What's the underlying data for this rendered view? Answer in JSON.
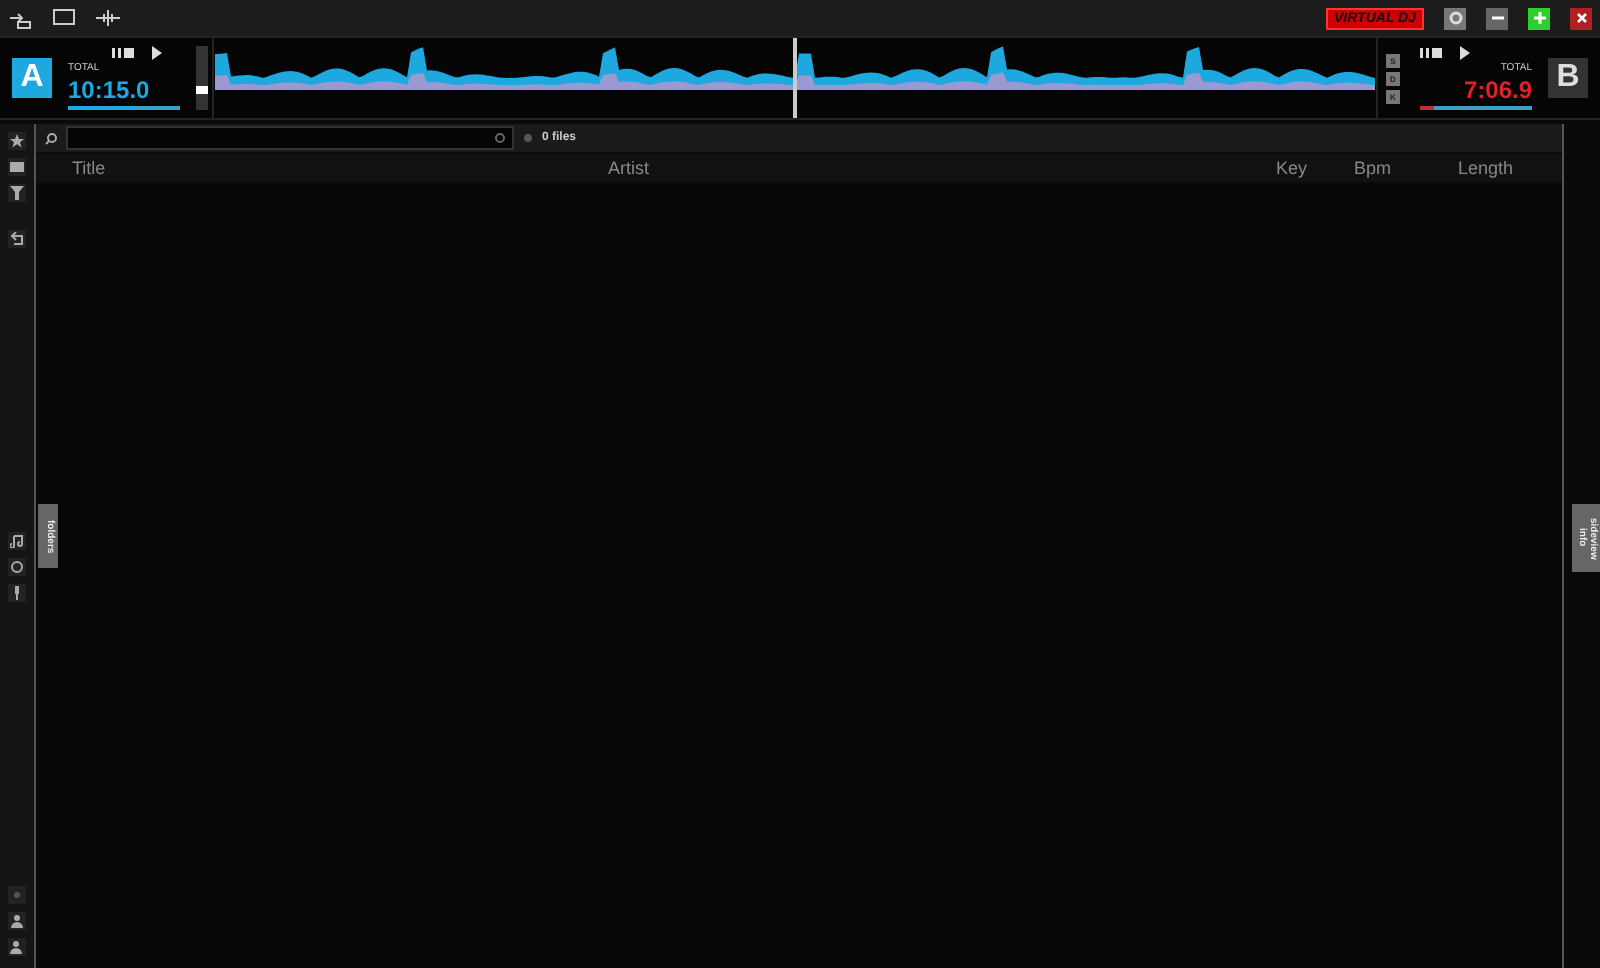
{
  "toolbar": {
    "logo": "VIRTUAL DJ"
  },
  "decks": [
    {
      "letter": "A",
      "total_label": "TOTAL",
      "time": "10:15.0",
      "color": "#1ea8e0",
      "position": {
        "level": 0.6
      }
    },
    {
      "letter": "B",
      "total_label": "TOTAL",
      "time": "7:06.9",
      "color": "#e0202a",
      "position": {
        "level": 0.12
      }
    }
  ],
  "fader": {
    "level": 0.3
  },
  "deck_buttons": [
    "S",
    "D",
    "K"
  ],
  "browser": {
    "file_count": "0 files",
    "columns": [
      "Title",
      "Artist",
      "Key",
      "Bpm",
      "Length"
    ],
    "left_tab": "folders",
    "right_tab": [
      "sideview",
      "info"
    ]
  }
}
